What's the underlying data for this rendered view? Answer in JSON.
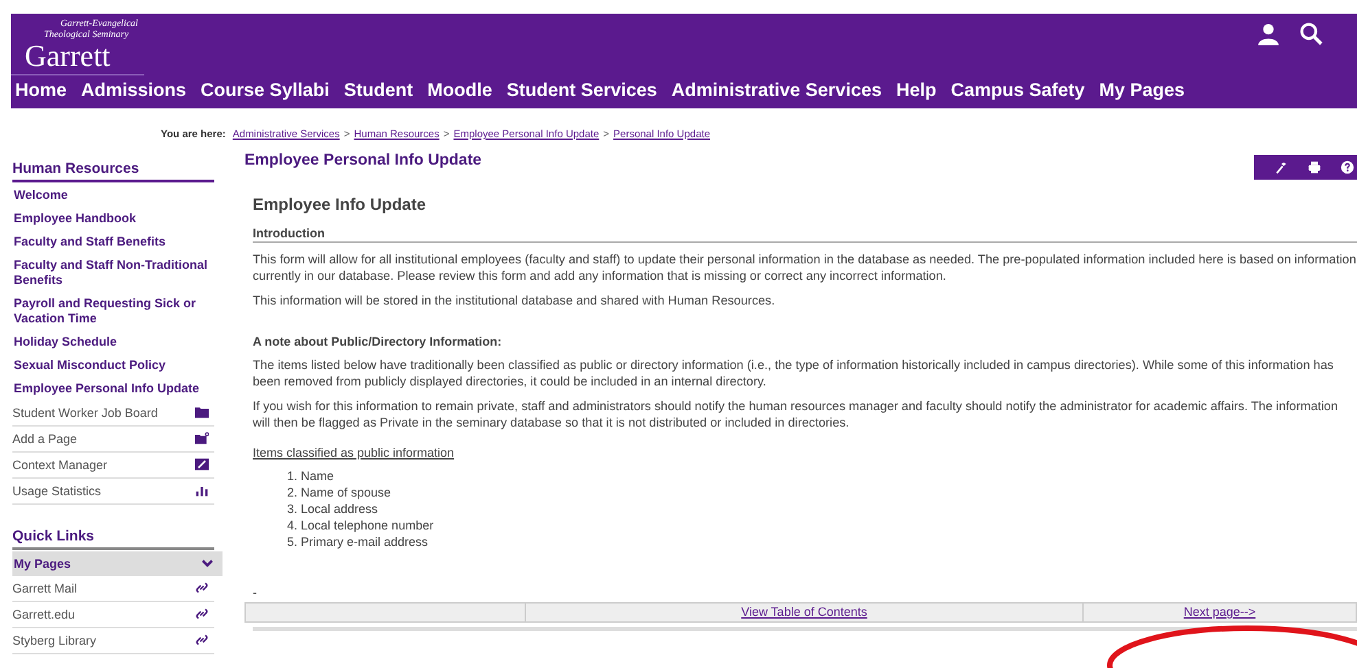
{
  "header": {
    "logo": {
      "line_1": "Garrett-Evangelical",
      "line_2": "Theological Seminary",
      "name": "Garrett"
    },
    "nav": [
      "Home",
      "Admissions",
      "Course Syllabi",
      "Student",
      "Moodle",
      "Student Services",
      "Administrative Services",
      "Help",
      "Campus Safety",
      "My Pages"
    ]
  },
  "breadcrumb": {
    "label": "You are here:",
    "links": [
      {
        "label": "Administrative Services",
        "separator": ">"
      },
      {
        "label": "Human Resources",
        "separator": ">"
      },
      {
        "label": "Employee Personal Info Update",
        "separator": ">"
      },
      {
        "label": "Personal Info Update"
      }
    ]
  },
  "sidebar": {
    "title": "Human Resources",
    "items": [
      {
        "label": "Welcome",
        "kind": "link"
      },
      {
        "label": "Employee Handbook",
        "kind": "link"
      },
      {
        "label": "Faculty and Staff Benefits",
        "kind": "link"
      },
      {
        "label": "Faculty and Staff Non-Traditional Benefits",
        "kind": "link"
      },
      {
        "label": "Payroll and Requesting Sick or Vacation Time",
        "kind": "link"
      },
      {
        "label": "Holiday Schedule",
        "kind": "link"
      },
      {
        "label": "Sexual Misconduct Policy",
        "kind": "link"
      },
      {
        "label": "Employee Personal Info Update",
        "kind": "link"
      },
      {
        "label": "Student Worker Job Board",
        "kind": "folder"
      },
      {
        "label": "Add a Page",
        "kind": "add"
      },
      {
        "label": "Context Manager",
        "kind": "edit"
      },
      {
        "label": "Usage Statistics",
        "kind": "stats"
      }
    ],
    "quick_links_title": "Quick Links",
    "quick_links": [
      {
        "label": "My Pages",
        "kind": "group"
      },
      {
        "label": "Garrett Mail",
        "kind": "link"
      },
      {
        "label": "Garrett.edu",
        "kind": "link"
      },
      {
        "label": "Styberg Library",
        "kind": "link"
      }
    ]
  },
  "main": {
    "page_title": "Employee Personal Info Update",
    "form_title": "Employee Info Update",
    "section": "Introduction",
    "intro": [
      "This form will allow for all institutional employees (faculty and staff) to update their personal information in the database as needed. The pre-populated information included here is based on information currently in our database. Please review this form and add any information that is missing or correct any incorrect information.",
      "This information will be stored in the institutional database and shared with Human Resources."
    ],
    "note_title": "A note about Public/Directory Information:",
    "note": [
      "The items listed below have traditionally been classified as public or directory information (i.e., the type of information historically included in campus directories). While some of this information has been removed from publicly displayed directories, it could be included in an internal directory.",
      "If you wish for this information to remain private, staff and administrators should notify the human resources manager and faculty should notify the administrator for academic affairs. The information will then be flagged as Private in the seminary database so that it is not distributed or included in directories."
    ],
    "list_title": "Items classified as public information",
    "list": [
      "1. Name",
      "2. Name of spouse",
      "3. Local address",
      "4. Local telephone number",
      "5. Primary e-mail address"
    ],
    "dash": "-",
    "pager": [
      "View Table of Contents",
      "Next page-->"
    ]
  }
}
